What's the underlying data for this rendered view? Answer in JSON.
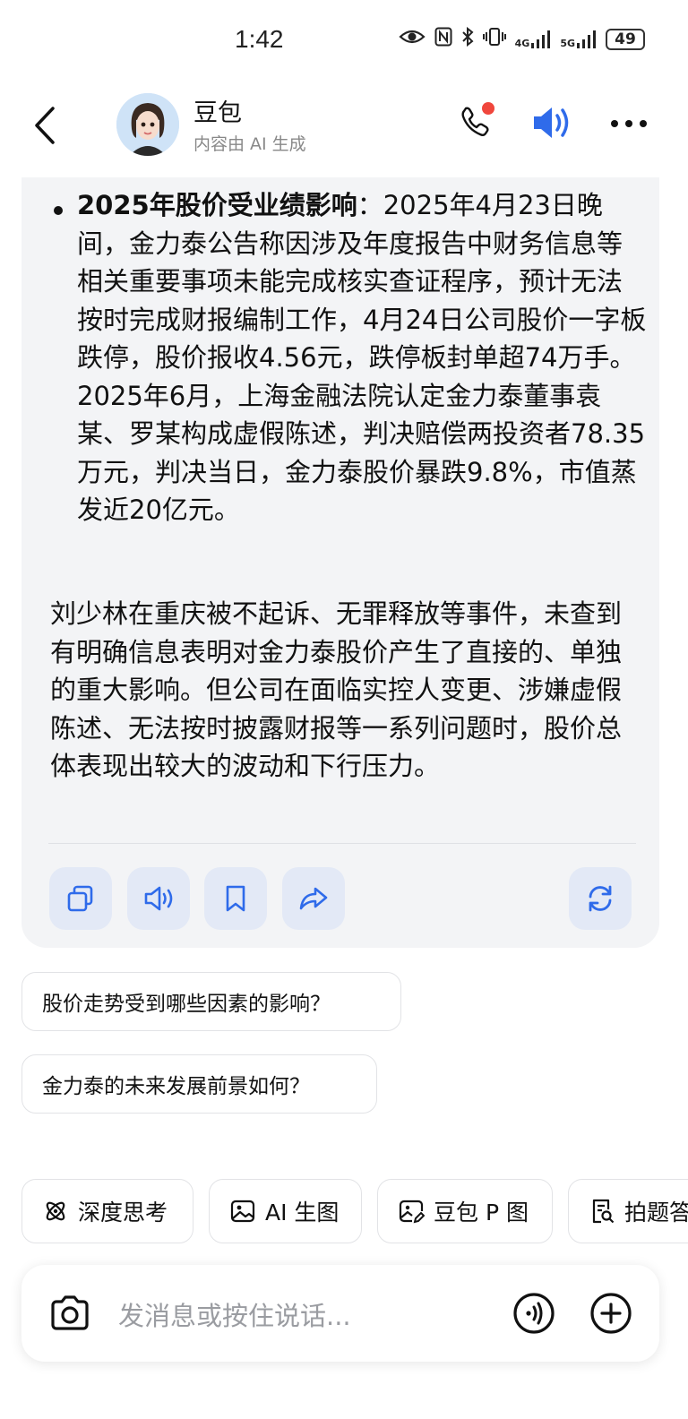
{
  "status_bar": {
    "time": "1:42",
    "signal_4g": "4G",
    "signal_5g": "5G",
    "battery": "49"
  },
  "header": {
    "name": "豆包",
    "subtitle": "内容由 AI 生成"
  },
  "message": {
    "bullet_title": "2025年股价受业绩影响",
    "bullet_body": "：2025年4月23日晚间，金力泰公告称因涉及年度报告中财务信息等相关重要事项未能完成核实查证程序，预计无法按时完成财报编制工作，4月24日公司股价一字板跌停，股价报收4.56元，跌停板封单超74万手。2025年6月，上海金融法院认定金力泰董事袁某、罗某构成虚假陈述，判决赔偿两投资者78.35万元，判决当日，金力泰股价暴跌9.8%，市值蒸发近20亿元。",
    "paragraph": "刘少林在重庆被不起诉、无罪释放等事件，未查到有明确信息表明对金力泰股价产生了直接的、单独的重大影响。但公司在面临实控人变更、涉嫌虚假陈述、无法按时披露财报等一系列问题时，股价总体表现出较大的波动和下行压力。"
  },
  "suggestions": [
    "股价走势受到哪些因素的影响？",
    "金力泰的未来发展前景如何？"
  ],
  "chips": [
    {
      "label": "深度思考",
      "icon": "atom-icon"
    },
    {
      "label": "AI 生图",
      "icon": "image-icon"
    },
    {
      "label": "豆包 P 图",
      "icon": "image-edit-icon"
    },
    {
      "label": "拍题答",
      "icon": "doc-search-icon"
    }
  ],
  "input": {
    "placeholder": "发消息或按住说话..."
  },
  "colors": {
    "accent": "#2f6bea",
    "card_bg": "#f3f4f6",
    "action_bg": "#e3e9f6",
    "badge": "#f0463c"
  }
}
